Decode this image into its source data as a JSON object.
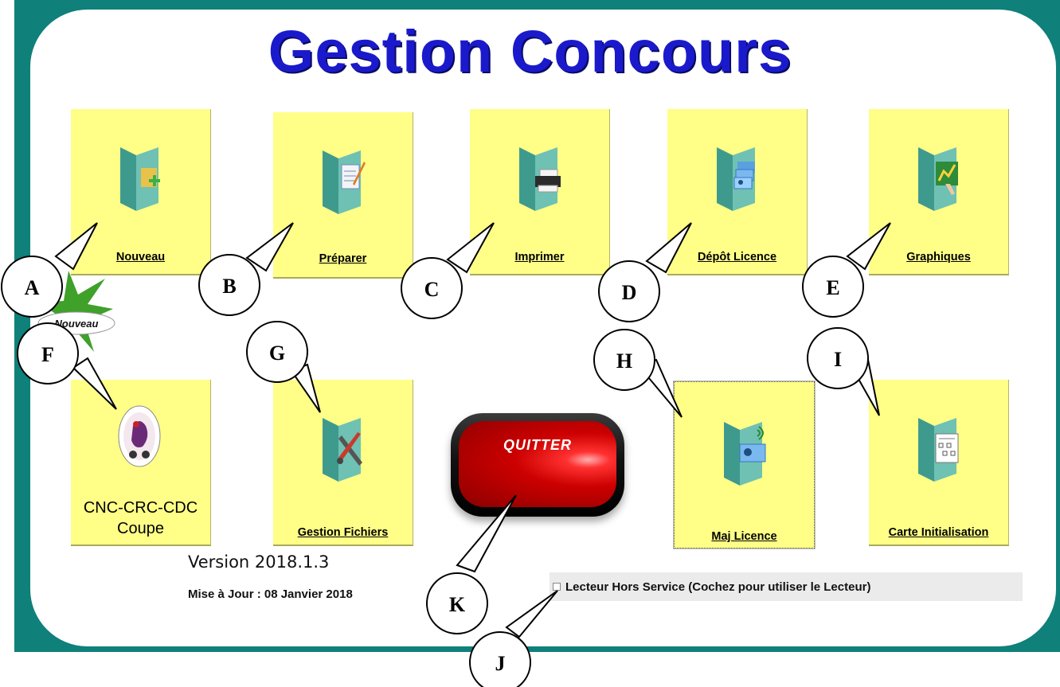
{
  "window": {
    "title": "Gestion Concours"
  },
  "tiles": [
    {
      "label": "Nouveau",
      "icon": "folder-add-icon"
    },
    {
      "label": "Préparer",
      "icon": "folder-edit-icon"
    },
    {
      "label": "Imprimer",
      "icon": "folder-printer-icon"
    },
    {
      "label": "Dépôt Licence",
      "icon": "folder-licence-cards-icon"
    },
    {
      "label": "Graphiques",
      "icon": "folder-chart-icon"
    },
    {
      "label_line1": "CNC-CRC-CDC",
      "label_line2": "Coupe",
      "icon": "federation-logo-icon"
    },
    {
      "label": "Gestion Fichiers",
      "icon": "folder-tools-icon"
    },
    {
      "label": "Maj Licence",
      "icon": "folder-wireless-licence-icon"
    },
    {
      "label": "Carte Initialisation",
      "icon": "folder-network-card-icon"
    }
  ],
  "new_badge": {
    "label": "Nouveau"
  },
  "quit_button": {
    "label": "QUITTER"
  },
  "version": "Version 2018.1.3",
  "update_date": "Mise à Jour : 08 Janvier 2018",
  "reader_checkbox": {
    "label": "Lecteur Hors Service (Cochez pour utiliser le Lecteur)",
    "checked": false
  },
  "callouts": [
    "A",
    "B",
    "C",
    "D",
    "E",
    "F",
    "G",
    "H",
    "I",
    "J",
    "K"
  ],
  "colors": {
    "frame": "#0f807a",
    "title": "#1a1acc",
    "tile": "#ffff88",
    "quit": "#cc0000"
  }
}
